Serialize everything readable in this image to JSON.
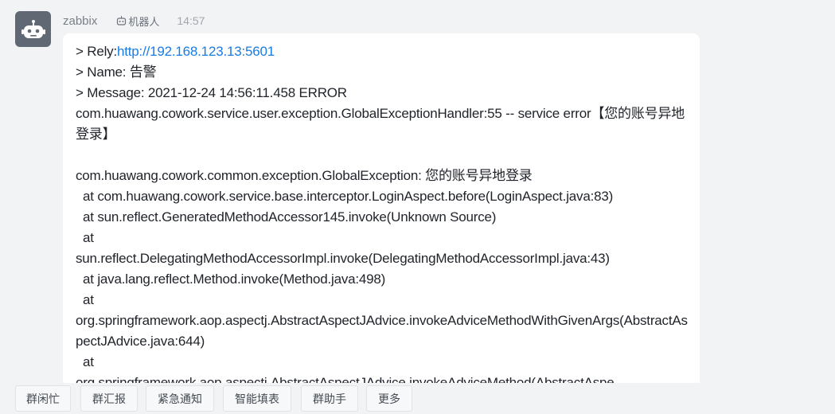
{
  "message": {
    "sender": "zabbix",
    "badge_label": "机器人",
    "time": "14:57",
    "avatar_icon": "robot-icon",
    "badge_icon": "robot-small-icon",
    "lines": [
      {
        "prefix": "> Rely:",
        "link": "http://192.168.123.13:5601"
      },
      {
        "text": "> Name: 告警"
      },
      {
        "text": "> Message: 2021-12-24 14:56:11.458 ERROR"
      },
      {
        "text": "com.huawang.cowork.service.user.exception.GlobalExceptionHandler:55 -- service error【您的账号异地登录】",
        "wrap": true
      },
      {
        "text": ""
      },
      {
        "text": "com.huawang.cowork.common.exception.GlobalException: 您的账号异地登录"
      },
      {
        "text": "  at com.huawang.cowork.service.base.interceptor.LoginAspect.before(LoginAspect.java:83)"
      },
      {
        "text": "  at sun.reflect.GeneratedMethodAccessor145.invoke(Unknown Source)"
      },
      {
        "text": "  at"
      },
      {
        "text": "sun.reflect.DelegatingMethodAccessorImpl.invoke(DelegatingMethodAccessorImpl.java:43)"
      },
      {
        "text": "  at java.lang.reflect.Method.invoke(Method.java:498)"
      },
      {
        "text": "  at"
      },
      {
        "text": "org.springframework.aop.aspectj.AbstractAspectJAdvice.invokeAdviceMethodWithGivenArgs(AbstractAspectJAdvice.java:644)",
        "wrap": true
      },
      {
        "text": "  at"
      },
      {
        "text": "org.springframework.aop.aspectj.AbstractAspectJAdvice.invokeAdviceMethod(AbstractAspe"
      }
    ]
  },
  "quick_actions": [
    "群闲忙",
    "群汇报",
    "紧急通知",
    "智能填表",
    "群助手",
    "更多"
  ],
  "colors": {
    "link": "#1a7be0",
    "avatar_bg": "#5f6873",
    "page_bg": "#f2f3f5"
  }
}
